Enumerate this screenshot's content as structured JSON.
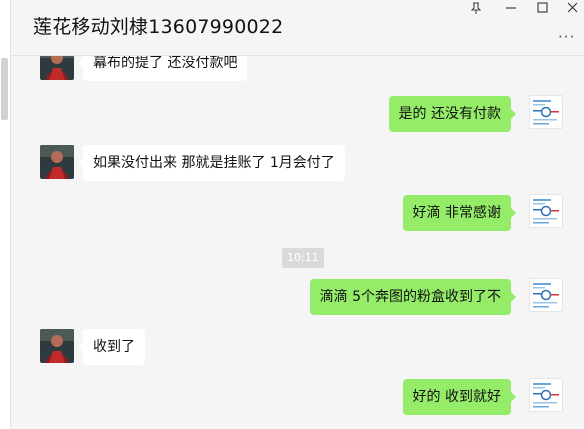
{
  "window": {
    "title": "莲花移动刘棣13607990022",
    "controls": [
      "pin-icon",
      "minimize-icon",
      "maximize-icon",
      "close-icon"
    ],
    "more_label": "···"
  },
  "chat": {
    "messages": [
      {
        "side": "left",
        "text": "幕布的提了 还没付款吧"
      },
      {
        "side": "right",
        "text": "是的  还没有付款"
      },
      {
        "side": "left",
        "text": "如果没付出来 那就是挂账了 1月会付了"
      },
      {
        "side": "right",
        "text": "好滴  非常感谢"
      },
      {
        "side": "right",
        "text": "滴滴 5个奔图的粉盒收到了不"
      },
      {
        "side": "left",
        "text": "收到了"
      },
      {
        "side": "right",
        "text": "好的 收到就好"
      }
    ],
    "timestamp": "10:11"
  },
  "colors": {
    "background": "#f5f5f5",
    "bubble_self": "#95ec69",
    "bubble_other": "#ffffff",
    "timestamp_bg": "#dadada"
  }
}
